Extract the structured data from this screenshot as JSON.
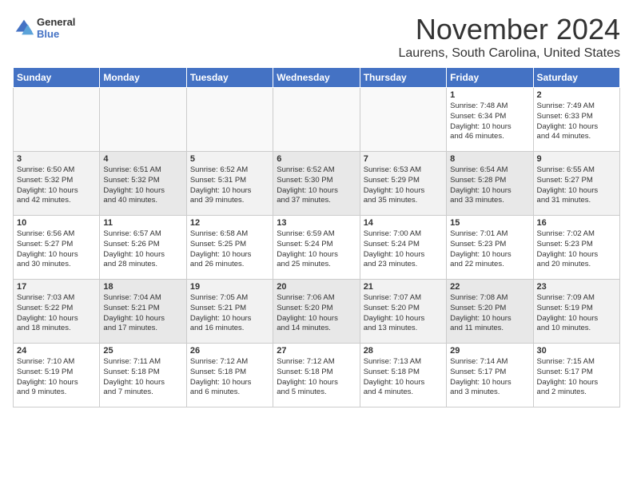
{
  "logo": {
    "name": "General",
    "name2": "Blue"
  },
  "title": "November 2024",
  "location": "Laurens, South Carolina, United States",
  "headers": [
    "Sunday",
    "Monday",
    "Tuesday",
    "Wednesday",
    "Thursday",
    "Friday",
    "Saturday"
  ],
  "weeks": [
    [
      {
        "day": "",
        "info": ""
      },
      {
        "day": "",
        "info": ""
      },
      {
        "day": "",
        "info": ""
      },
      {
        "day": "",
        "info": ""
      },
      {
        "day": "",
        "info": ""
      },
      {
        "day": "1",
        "info": "Sunrise: 7:48 AM\nSunset: 6:34 PM\nDaylight: 10 hours\nand 46 minutes."
      },
      {
        "day": "2",
        "info": "Sunrise: 7:49 AM\nSunset: 6:33 PM\nDaylight: 10 hours\nand 44 minutes."
      }
    ],
    [
      {
        "day": "3",
        "info": "Sunrise: 6:50 AM\nSunset: 5:32 PM\nDaylight: 10 hours\nand 42 minutes."
      },
      {
        "day": "4",
        "info": "Sunrise: 6:51 AM\nSunset: 5:32 PM\nDaylight: 10 hours\nand 40 minutes."
      },
      {
        "day": "5",
        "info": "Sunrise: 6:52 AM\nSunset: 5:31 PM\nDaylight: 10 hours\nand 39 minutes."
      },
      {
        "day": "6",
        "info": "Sunrise: 6:52 AM\nSunset: 5:30 PM\nDaylight: 10 hours\nand 37 minutes."
      },
      {
        "day": "7",
        "info": "Sunrise: 6:53 AM\nSunset: 5:29 PM\nDaylight: 10 hours\nand 35 minutes."
      },
      {
        "day": "8",
        "info": "Sunrise: 6:54 AM\nSunset: 5:28 PM\nDaylight: 10 hours\nand 33 minutes."
      },
      {
        "day": "9",
        "info": "Sunrise: 6:55 AM\nSunset: 5:27 PM\nDaylight: 10 hours\nand 31 minutes."
      }
    ],
    [
      {
        "day": "10",
        "info": "Sunrise: 6:56 AM\nSunset: 5:27 PM\nDaylight: 10 hours\nand 30 minutes."
      },
      {
        "day": "11",
        "info": "Sunrise: 6:57 AM\nSunset: 5:26 PM\nDaylight: 10 hours\nand 28 minutes."
      },
      {
        "day": "12",
        "info": "Sunrise: 6:58 AM\nSunset: 5:25 PM\nDaylight: 10 hours\nand 26 minutes."
      },
      {
        "day": "13",
        "info": "Sunrise: 6:59 AM\nSunset: 5:24 PM\nDaylight: 10 hours\nand 25 minutes."
      },
      {
        "day": "14",
        "info": "Sunrise: 7:00 AM\nSunset: 5:24 PM\nDaylight: 10 hours\nand 23 minutes."
      },
      {
        "day": "15",
        "info": "Sunrise: 7:01 AM\nSunset: 5:23 PM\nDaylight: 10 hours\nand 22 minutes."
      },
      {
        "day": "16",
        "info": "Sunrise: 7:02 AM\nSunset: 5:23 PM\nDaylight: 10 hours\nand 20 minutes."
      }
    ],
    [
      {
        "day": "17",
        "info": "Sunrise: 7:03 AM\nSunset: 5:22 PM\nDaylight: 10 hours\nand 18 minutes."
      },
      {
        "day": "18",
        "info": "Sunrise: 7:04 AM\nSunset: 5:21 PM\nDaylight: 10 hours\nand 17 minutes."
      },
      {
        "day": "19",
        "info": "Sunrise: 7:05 AM\nSunset: 5:21 PM\nDaylight: 10 hours\nand 16 minutes."
      },
      {
        "day": "20",
        "info": "Sunrise: 7:06 AM\nSunset: 5:20 PM\nDaylight: 10 hours\nand 14 minutes."
      },
      {
        "day": "21",
        "info": "Sunrise: 7:07 AM\nSunset: 5:20 PM\nDaylight: 10 hours\nand 13 minutes."
      },
      {
        "day": "22",
        "info": "Sunrise: 7:08 AM\nSunset: 5:20 PM\nDaylight: 10 hours\nand 11 minutes."
      },
      {
        "day": "23",
        "info": "Sunrise: 7:09 AM\nSunset: 5:19 PM\nDaylight: 10 hours\nand 10 minutes."
      }
    ],
    [
      {
        "day": "24",
        "info": "Sunrise: 7:10 AM\nSunset: 5:19 PM\nDaylight: 10 hours\nand 9 minutes."
      },
      {
        "day": "25",
        "info": "Sunrise: 7:11 AM\nSunset: 5:18 PM\nDaylight: 10 hours\nand 7 minutes."
      },
      {
        "day": "26",
        "info": "Sunrise: 7:12 AM\nSunset: 5:18 PM\nDaylight: 10 hours\nand 6 minutes."
      },
      {
        "day": "27",
        "info": "Sunrise: 7:12 AM\nSunset: 5:18 PM\nDaylight: 10 hours\nand 5 minutes."
      },
      {
        "day": "28",
        "info": "Sunrise: 7:13 AM\nSunset: 5:18 PM\nDaylight: 10 hours\nand 4 minutes."
      },
      {
        "day": "29",
        "info": "Sunrise: 7:14 AM\nSunset: 5:17 PM\nDaylight: 10 hours\nand 3 minutes."
      },
      {
        "day": "30",
        "info": "Sunrise: 7:15 AM\nSunset: 5:17 PM\nDaylight: 10 hours\nand 2 minutes."
      }
    ]
  ]
}
